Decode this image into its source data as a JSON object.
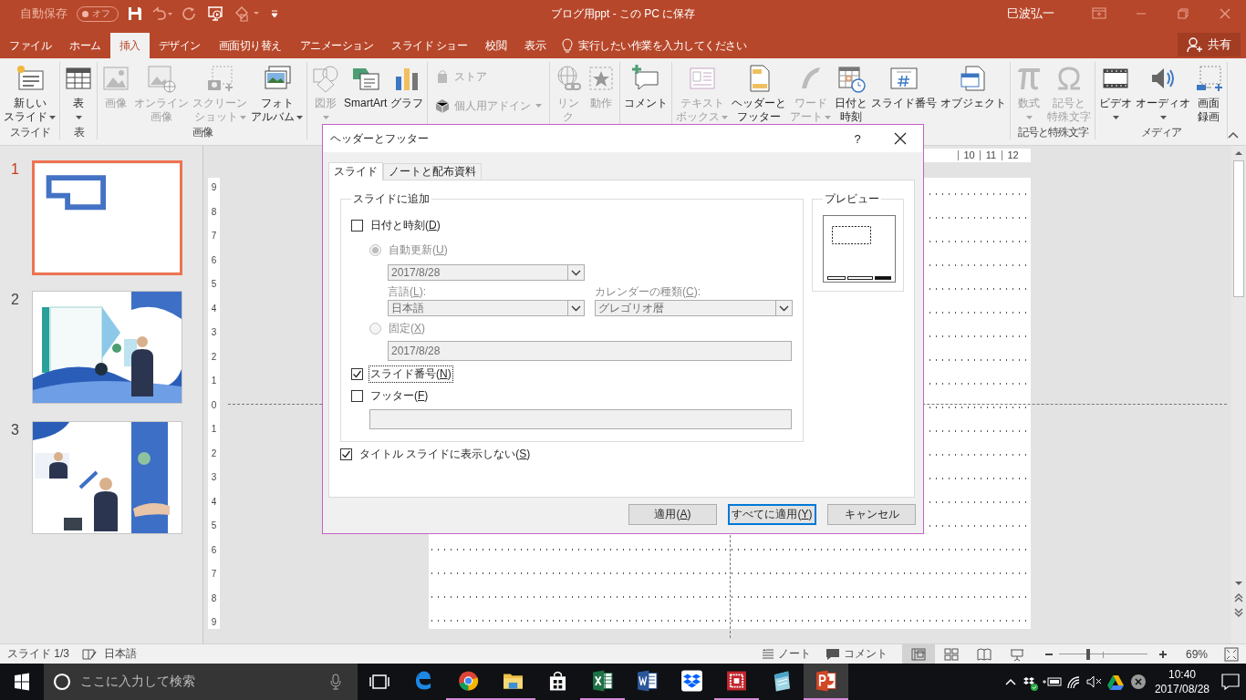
{
  "title_bar": {
    "autosave_label": "自動保存",
    "autosave_state": "オフ",
    "autosave_on": false,
    "document_title": "ブログ用ppt - この PC に保存",
    "user_name": "巳波弘一"
  },
  "ribbon_tabs": [
    {
      "label": "ファイル",
      "selected": false
    },
    {
      "label": "ホーム",
      "selected": false
    },
    {
      "label": "挿入",
      "selected": true
    },
    {
      "label": "デザイン",
      "selected": false
    },
    {
      "label": "画面切り替え",
      "selected": false
    },
    {
      "label": "アニメーション",
      "selected": false
    },
    {
      "label": "スライド ショー",
      "selected": false
    },
    {
      "label": "校閲",
      "selected": false
    },
    {
      "label": "表示",
      "selected": false
    }
  ],
  "tell_me": "実行したい作業を入力してください",
  "share_button": "共有",
  "ribbon_groups": [
    {
      "label": "スライド",
      "commands": [
        {
          "lines": [
            "新しい",
            "スライド"
          ],
          "dropdown": true,
          "disabled": false
        }
      ]
    },
    {
      "label": "表",
      "commands": [
        {
          "lines": [
            "表"
          ],
          "dropdown": true,
          "disabled": false
        }
      ]
    },
    {
      "label": "画像",
      "commands": [
        {
          "lines": [
            "画像"
          ],
          "dropdown": false,
          "disabled": true
        },
        {
          "lines": [
            "オンライン",
            "画像"
          ],
          "dropdown": false,
          "disabled": true
        },
        {
          "lines": [
            "スクリーン",
            "ショット"
          ],
          "dropdown": true,
          "disabled": true
        },
        {
          "lines": [
            "フォト",
            "アルバム"
          ],
          "dropdown": true,
          "disabled": false
        }
      ]
    },
    {
      "commands": [
        {
          "lines": [
            "図形"
          ],
          "dropdown": true,
          "disabled": true
        },
        {
          "lines": [
            "SmartArt"
          ],
          "dropdown": false,
          "disabled": false
        },
        {
          "lines": [
            "グラフ"
          ],
          "dropdown": false,
          "disabled": false
        }
      ]
    },
    {
      "small_commands": [
        {
          "label": "ストア",
          "dropdown": false,
          "disabled": true
        },
        {
          "label": "個人用アドイン",
          "dropdown": true,
          "disabled": true
        }
      ]
    },
    {
      "commands": [
        {
          "lines": [
            "リン",
            "ク"
          ],
          "dropdown": false,
          "disabled": true
        },
        {
          "lines": [
            "動作"
          ],
          "dropdown": false,
          "disabled": true
        }
      ]
    },
    {
      "commands": [
        {
          "lines": [
            "コメント"
          ],
          "dropdown": false,
          "disabled": false
        }
      ]
    },
    {
      "commands": [
        {
          "lines": [
            "テキスト",
            "ボックス"
          ],
          "dropdown": true,
          "disabled": true
        },
        {
          "lines": [
            "ヘッダーと",
            "フッター"
          ],
          "dropdown": false,
          "disabled": false
        },
        {
          "lines": [
            "ワード",
            "アート"
          ],
          "dropdown": true,
          "disabled": true
        },
        {
          "lines": [
            "日付と",
            "時刻"
          ],
          "dropdown": false,
          "disabled": false
        },
        {
          "lines": [
            "スライド番号"
          ],
          "dropdown": false,
          "disabled": false
        },
        {
          "lines": [
            "オブジェクト"
          ],
          "dropdown": false,
          "disabled": false
        }
      ]
    },
    {
      "label": "記号と特殊文字",
      "commands": [
        {
          "lines": [
            "数式"
          ],
          "dropdown": true,
          "disabled": true
        },
        {
          "lines": [
            "記号と",
            "特殊文字"
          ],
          "dropdown": false,
          "disabled": true
        }
      ]
    },
    {
      "label": "メディア",
      "commands": [
        {
          "lines": [
            "ビデオ"
          ],
          "dropdown": true,
          "disabled": false
        },
        {
          "lines": [
            "オーディオ"
          ],
          "dropdown": true,
          "disabled": false
        },
        {
          "lines": [
            "画面",
            "録画"
          ],
          "dropdown": false,
          "disabled": false
        }
      ]
    }
  ],
  "thumbnails": [
    {
      "number": "1",
      "selected": true,
      "kind": "picture"
    },
    {
      "number": "2",
      "selected": false,
      "kind": "picture"
    },
    {
      "number": "3",
      "selected": false,
      "kind": "picture"
    }
  ],
  "rulers": {
    "horizontal": [
      "10",
      "11",
      "12"
    ],
    "vertical": [
      "9",
      "8",
      "7",
      "6",
      "5",
      "4",
      "3",
      "2",
      "1",
      "0",
      "1",
      "2",
      "3",
      "4",
      "5",
      "6",
      "7",
      "8",
      "9"
    ]
  },
  "dialog": {
    "title": "ヘッダーとフッター",
    "help_button": "?",
    "tabs": [
      {
        "label": "スライド",
        "selected": true
      },
      {
        "label": "ノートと配布資料",
        "selected": false
      }
    ],
    "add_to_slide": {
      "label": "スライドに追加",
      "date_time": {
        "label_start": "日付と時刻(",
        "access_key": "D",
        "label_end": ")",
        "checked": false,
        "focused": false
      },
      "auto_update": {
        "label_start": "自動更新(",
        "access_key": "U",
        "label_end": ")",
        "selected": true,
        "disabled": true,
        "value": "2017/8/28"
      },
      "language": {
        "label_start": "言語(",
        "access_key": "L",
        "label_end": "):",
        "value": "日本語",
        "disabled": true
      },
      "calendar": {
        "label_start": "カレンダーの種類(",
        "access_key": "C",
        "label_end": "):",
        "value": "グレゴリオ暦",
        "disabled": true
      },
      "fixed": {
        "label_start": "固定(",
        "access_key": "X",
        "label_end": ")",
        "selected": false,
        "disabled": true,
        "value": "2017/8/28"
      },
      "slide_number": {
        "label_start": "スライド番号(",
        "access_key": "N",
        "label_end": ")",
        "checked": true,
        "focused": true
      },
      "footer": {
        "label_start": "フッター(",
        "access_key": "F",
        "label_end": ")",
        "checked": false,
        "focused": false,
        "field_disabled": true
      }
    },
    "preview_label": "プレビュー",
    "dont_show_on_title": {
      "label_start": "タイトル スライドに表示しない(",
      "access_key": "S",
      "label_end": ")",
      "checked": true,
      "focused": false
    },
    "buttons": [
      {
        "label_start": "適用(",
        "access_key": "A",
        "label_end": ")",
        "default": false
      },
      {
        "label_start": "すべてに適用(",
        "access_key": "Y",
        "label_end": ")",
        "default": true
      },
      {
        "label_start": "キャンセル",
        "default": false
      }
    ]
  },
  "status_bar": {
    "slide_indicator": "スライド 1/3",
    "language": "日本語",
    "notes_button": "ノート",
    "comments_button": "コメント",
    "views": [
      {
        "selected": true
      },
      {
        "selected": false
      },
      {
        "selected": false
      },
      {
        "selected": false
      }
    ],
    "zoom": {
      "level": 0.33,
      "reading": "69%"
    }
  },
  "taskbar": {
    "search_placeholder": "ここに入力して検索",
    "apps": [
      {
        "running": false,
        "active": false
      },
      {
        "running": true,
        "active": false
      },
      {
        "running": true,
        "active": false
      },
      {
        "running": false,
        "active": false
      },
      {
        "running": true,
        "active": false
      },
      {
        "running": false,
        "active": false
      },
      {
        "running": false,
        "active": false
      },
      {
        "running": true,
        "active": false
      },
      {
        "running": false,
        "active": false
      },
      {
        "running": true,
        "active": true
      }
    ],
    "time": "10:40",
    "date": "2017/08/28"
  }
}
